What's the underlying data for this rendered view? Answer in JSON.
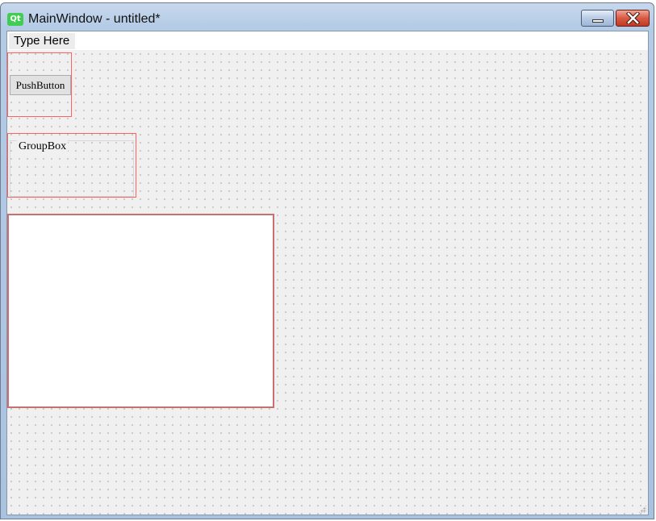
{
  "window": {
    "title": "MainWindow - untitled*",
    "logo_text": "Qt"
  },
  "menubar": {
    "items": [
      {
        "label": "Type Here"
      }
    ]
  },
  "form": {
    "push_button_label": "PushButton",
    "group_box_title": "GroupBox"
  },
  "colors": {
    "selection_border": "#ff6060",
    "qt_logo": "#41cd52",
    "close_button": "#c23a22"
  },
  "icons": {
    "app": "qt-logo-icon",
    "minimize": "minimize-icon",
    "close": "close-icon",
    "size_grip": "size-grip-icon"
  }
}
